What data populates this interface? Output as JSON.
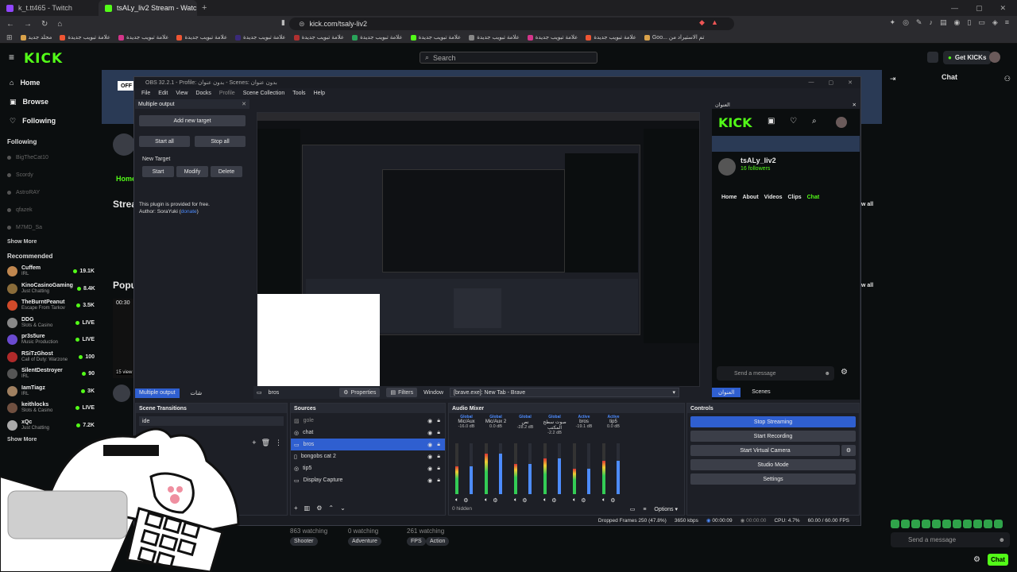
{
  "browser": {
    "tabs": [
      {
        "label": "k_t.tt465 - Twitch",
        "active": false
      },
      {
        "label": "tsALy_liv2 Stream - Watch Live o",
        "active": true
      }
    ],
    "url": "kick.com/tsaly-liv2",
    "bookmarks": [
      "مجلد جديد",
      "علامة تبويب جديدة",
      "علامة تبويب جديدة",
      "علامة تبويب جديدة",
      "علامة تبويب جديدة",
      "علامة تبويب جديدة",
      "علامة تبويب جديدة",
      "علامة تبويب جديدة",
      "علامة تبويب جديدة",
      "علامة تبويب جديدة",
      "علامة تبويب جديدة",
      "Goo... تم الاستيراد من"
    ]
  },
  "kick": {
    "logo": "KICK",
    "search_placeholder": "Search",
    "get_kicks": "Get KICKs",
    "nav": [
      {
        "icon": "home-icon",
        "label": "Home"
      },
      {
        "icon": "browse-icon",
        "label": "Browse"
      },
      {
        "icon": "heart-icon",
        "label": "Following"
      }
    ],
    "following_title": "Following",
    "following": [
      "BigTheCat10",
      "Scordy",
      "AstroRAY",
      "qfazek",
      "M7MD_Sa"
    ],
    "show_more": "Show More",
    "recommended_title": "Recommended",
    "recommended": [
      {
        "name": "Cuffem",
        "cat": "IRL",
        "viewers": "19.1K",
        "color": "#c0874f"
      },
      {
        "name": "KinoCasinoGaming",
        "cat": "Just Chatting",
        "viewers": "8.4K",
        "color": "#8a6c3a"
      },
      {
        "name": "TheBurntPeanut",
        "cat": "Escape From Tarkov",
        "viewers": "3.5K",
        "color": "#d04a2a"
      },
      {
        "name": "DDG",
        "cat": "Slots & Casino",
        "viewers": "LIVE",
        "color": "#888"
      },
      {
        "name": "pr3s5ure",
        "cat": "Music Production",
        "viewers": "LIVE",
        "color": "#6a4ad0"
      },
      {
        "name": "RSiTzGhost",
        "cat": "Call of Duty: Warzone",
        "viewers": "100",
        "color": "#b02a2a"
      },
      {
        "name": "SilentDestroyer",
        "cat": "IRL",
        "viewers": "90",
        "color": "#555"
      },
      {
        "name": "IamTiagz",
        "cat": "IRL",
        "viewers": "3K",
        "color": "#a08060"
      },
      {
        "name": "keithlocks",
        "cat": "Slots & Casino",
        "viewers": "LIVE",
        "color": "#705040"
      },
      {
        "name": "xQc",
        "cat": "Just Chatting",
        "viewers": "7.2K",
        "color": "#aaa"
      }
    ],
    "show_more2": "Show More",
    "chat_title": "Chat",
    "send_placeholder": "Send a message",
    "chat_button": "Chat",
    "home_tab": "Home",
    "streams_heading": "Strea",
    "popular_heading": "Popu",
    "time_label": "00:30",
    "views_label": "15 view",
    "view_all_1": "w all",
    "view_all_2": "w all",
    "lower_watch": [
      "863 watching",
      "0 watching",
      "261 watching"
    ],
    "lower_tags": [
      "Shooter",
      "Adventure",
      "FPS",
      "Action"
    ]
  },
  "obs": {
    "title": "OBS 32.2.1 - Profile: بدون عنوان - Scenes: بدون عنوان",
    "menu": [
      "File",
      "Edit",
      "View",
      "Docks",
      "Profile",
      "Scene Collection",
      "Tools",
      "Help"
    ],
    "multi": {
      "title": "Multiple output",
      "add_target": "Add new target",
      "start_all": "Start all",
      "stop_all": "Stop all",
      "new_target": "New Target",
      "start": "Start",
      "modify": "Modify",
      "delete": "Delete",
      "note1": "This plugin is provided for free.",
      "note2": "Author: SoraYuki (",
      "donate": "donate",
      "note3": ")"
    },
    "tabs_left": [
      "Multiple output",
      "شات"
    ],
    "dockbar": {
      "source": "bros",
      "properties": "Properties",
      "filters": "Filters",
      "window_label": "Window",
      "window_value": "[brave.exe]: New Tab - Brave"
    },
    "scene_transitions": {
      "title": "Scene Transitions",
      "value": "ide"
    },
    "sources": {
      "title": "Sources",
      "items": [
        {
          "name": "gole",
          "icon": "image-icon",
          "selected": false,
          "dim": true
        },
        {
          "name": "chat",
          "icon": "browser-icon",
          "selected": false,
          "dim": false
        },
        {
          "name": "bros",
          "icon": "window-icon",
          "selected": true,
          "dim": false
        },
        {
          "name": "bongobs cat 2",
          "icon": "source-icon",
          "selected": false,
          "dim": false
        },
        {
          "name": "tip5",
          "icon": "browser-icon",
          "selected": false,
          "dim": false
        },
        {
          "name": "Display Capture",
          "icon": "monitor-icon",
          "selected": false,
          "dim": false
        }
      ]
    },
    "mixer": {
      "title": "Audio Mixer",
      "hidden": "0 hidden",
      "options": "Options",
      "channels": [
        {
          "tag": "Global",
          "name": "Mic/Aux",
          "db": "-16.0 dB",
          "level": 0.55
        },
        {
          "tag": "Global",
          "name": "Mic/Aux 2",
          "db": "0.0 dB",
          "level": 0.8
        },
        {
          "tag": "Global",
          "name": "نص",
          "db": "-28.2 dB",
          "level": 0.6
        },
        {
          "tag": "Global",
          "name": "صوت سطح المكتب",
          "db": "-2.2 dB",
          "level": 0.7
        },
        {
          "tag": "Active",
          "name": "bros",
          "db": "-19.1 dB",
          "level": 0.5
        },
        {
          "tag": "Active",
          "name": "tip5",
          "db": "0.0 dB",
          "level": 0.65
        }
      ]
    },
    "controls": {
      "title": "Controls",
      "items": [
        "Stop Streaming",
        "Start Recording",
        "Start Virtual Camera",
        "Studio Mode",
        "Settings"
      ]
    },
    "status": {
      "dropped": "Dropped Frames 250 (47.8%)",
      "kbps": "3650 kbps",
      "stream_time": "00:00:09",
      "rec_time": "00:00:00",
      "cpu": "CPU: 4.7%",
      "fps": "60.00 / 60.00 FPS"
    },
    "chat_dock": {
      "title": "العنوان",
      "logo": "KICK",
      "channel": "tsALy_liv2",
      "followers": "16 followers",
      "tabs": [
        "Home",
        "About",
        "Videos",
        "Clips",
        "Chat"
      ],
      "send_placeholder": "Send a message",
      "dock_tabs": [
        "العنوان",
        "Scenes"
      ]
    }
  }
}
